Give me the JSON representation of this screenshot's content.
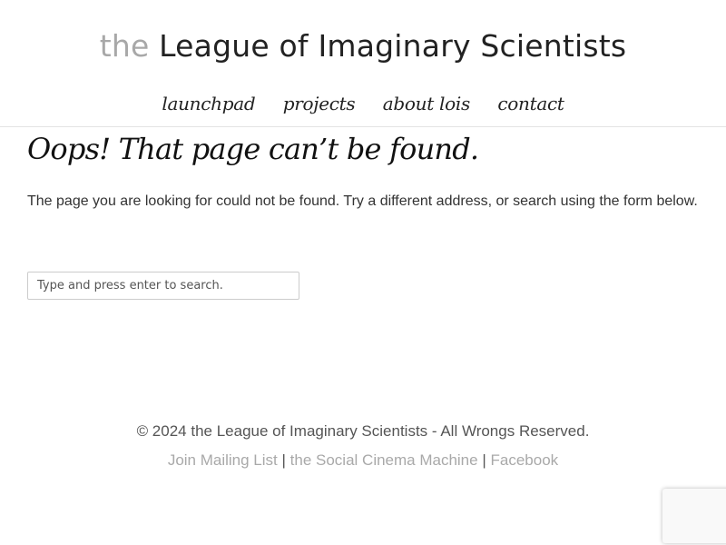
{
  "header": {
    "logo_prefix": "the",
    "logo_main": "League of Imaginary Scientists"
  },
  "nav": {
    "items": [
      {
        "label": "launchpad"
      },
      {
        "label": "projects"
      },
      {
        "label": "about lois"
      },
      {
        "label": "contact"
      }
    ]
  },
  "main": {
    "title": "Oops! That page can’t be found.",
    "message": "The page you are looking for could not be found. Try a different address, or search using the form below.",
    "search": {
      "placeholder": "Type and press enter to search.",
      "value": ""
    }
  },
  "footer": {
    "copyright": "© 2024 the League of Imaginary Scientists - All Wrongs Reserved.",
    "links": [
      {
        "label": "Join Mailing List"
      },
      {
        "label": "the Social Cinema Machine"
      },
      {
        "label": "Facebook"
      }
    ],
    "separator": "|"
  },
  "colors": {
    "link_gray": "#a9a9a9",
    "text_dark": "#222222",
    "logo_prefix_gray": "#a8a8a8"
  }
}
